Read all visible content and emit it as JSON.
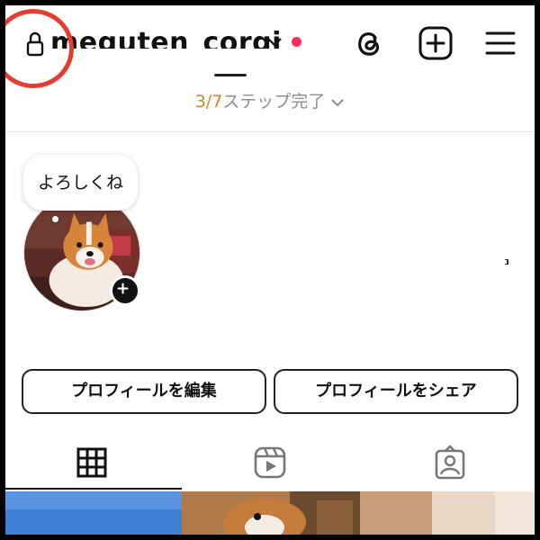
{
  "header": {
    "username": "meguten_corgi",
    "lock_icon": "lock-icon",
    "dropdown_icon": "chevron-down-icon",
    "notification_color": "#ff2d55",
    "threads_icon": "threads-icon",
    "create_icon": "plus-square-icon",
    "menu_icon": "hamburger-menu-icon"
  },
  "steps": {
    "count": "3/7",
    "label": "ステップ完了"
  },
  "note": {
    "text": "よろしくね"
  },
  "profile": {
    "avatar": "corgi-avatar",
    "add_story_icon": "plus-icon"
  },
  "buttons": {
    "edit_profile": "プロフィールを編集",
    "share_profile": "プロフィールをシェア"
  },
  "tabs": [
    {
      "name": "posts",
      "icon": "grid-icon",
      "active": true
    },
    {
      "name": "reels",
      "icon": "reels-icon",
      "active": false
    },
    {
      "name": "tagged",
      "icon": "tagged-icon",
      "active": false
    }
  ],
  "colors": {
    "accent_orange": "#d9822b",
    "annotation_red": "#e63b2e"
  }
}
